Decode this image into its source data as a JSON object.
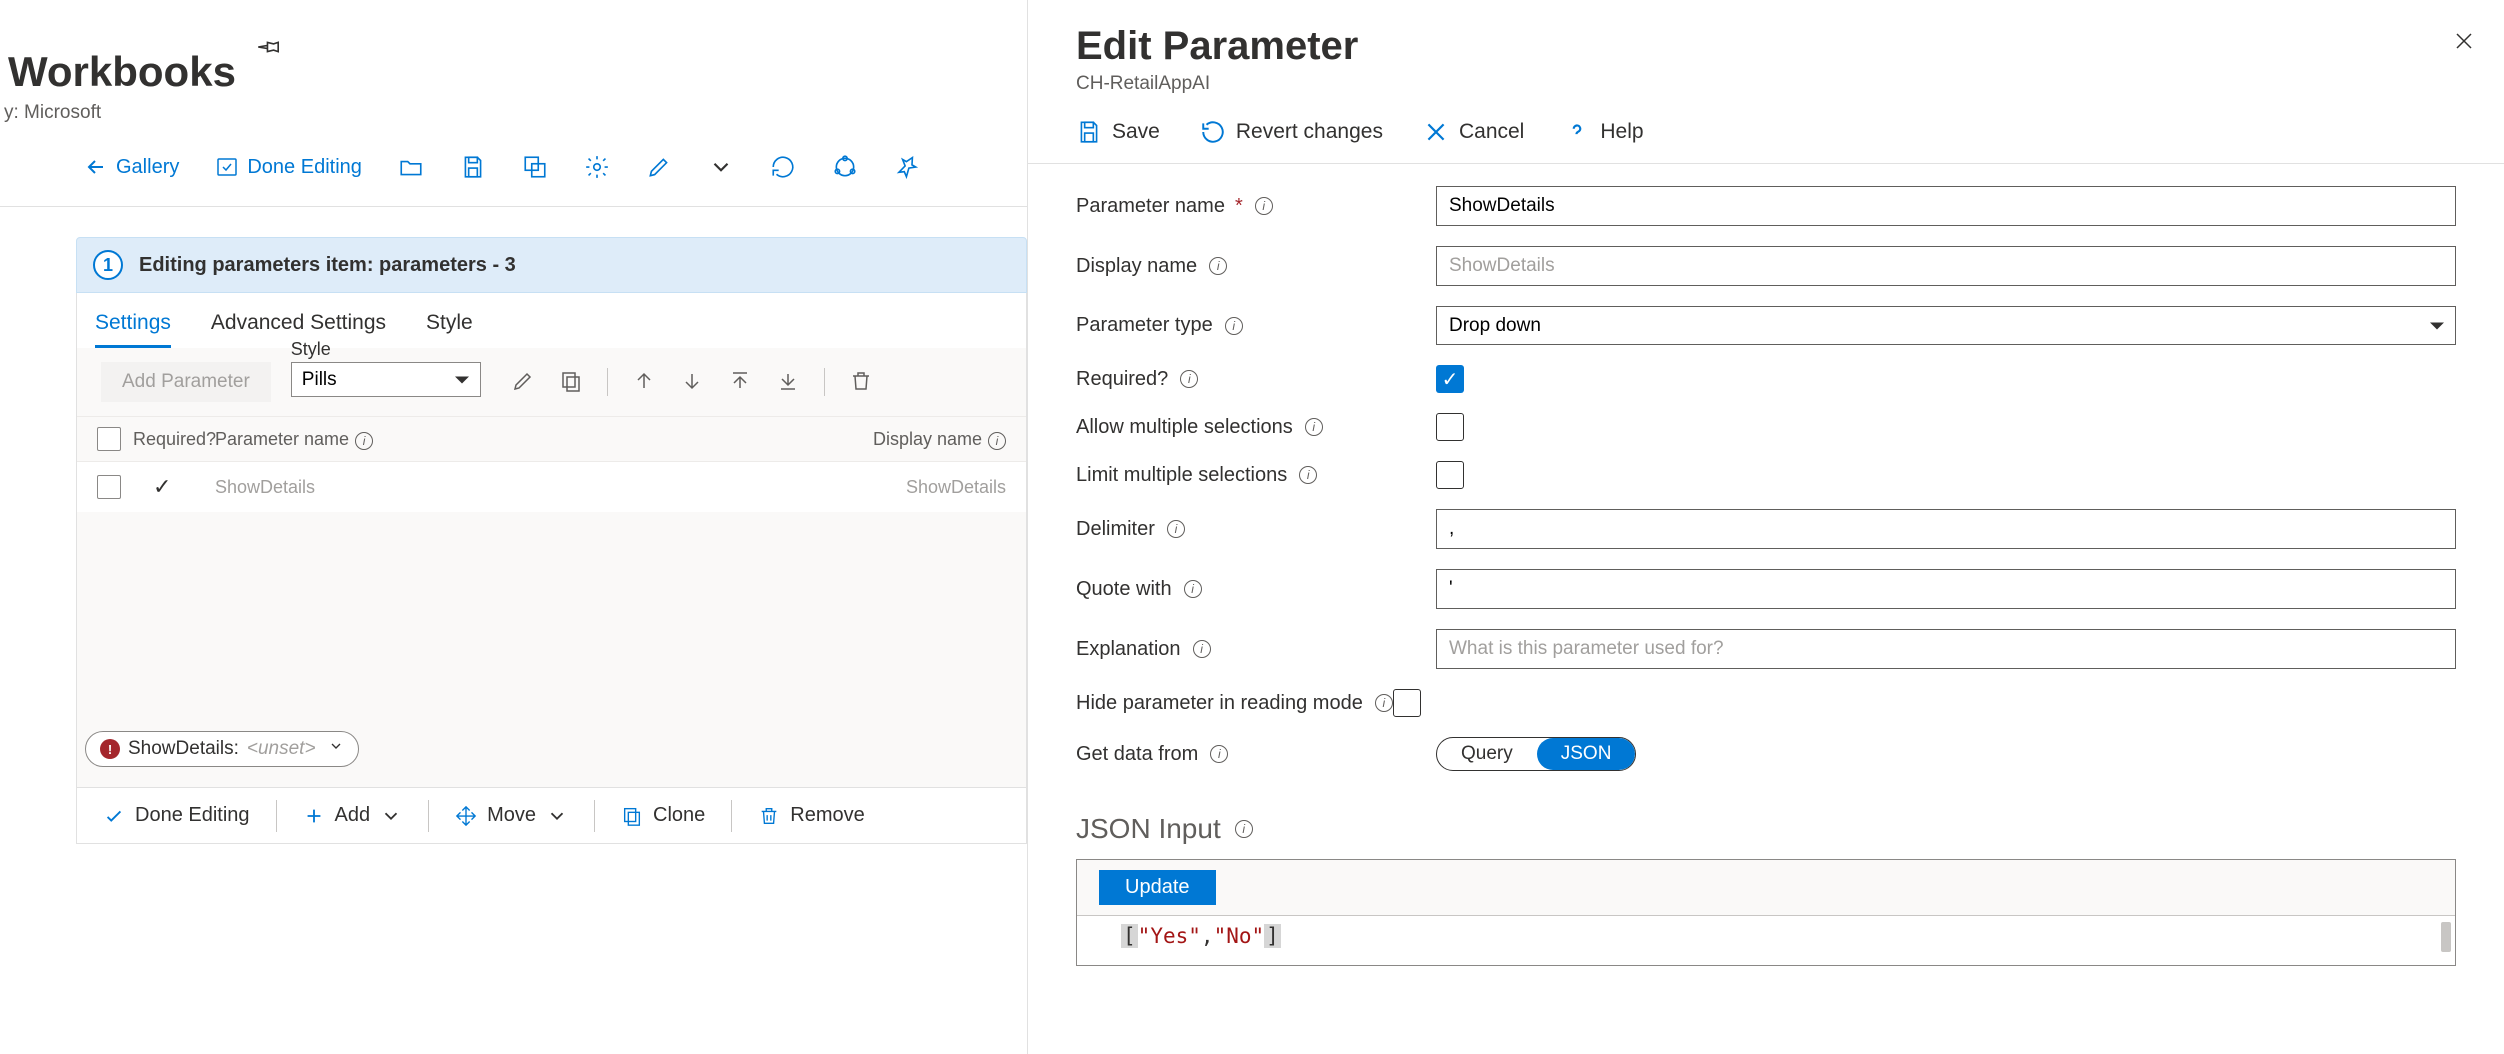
{
  "page": {
    "title": "Workbooks",
    "subtitle": "y: Microsoft"
  },
  "toolbar": {
    "gallery": "Gallery",
    "done_editing": "Done Editing"
  },
  "item": {
    "step": "1",
    "header": "Editing parameters item: parameters - 3",
    "tabs": {
      "settings": "Settings",
      "advanced": "Advanced Settings",
      "style": "Style"
    },
    "add_param": "Add Parameter",
    "style_label": "Style",
    "style_value": "Pills",
    "cols": {
      "required": "Required?",
      "pname": "Parameter name",
      "dname": "Display name"
    },
    "row": {
      "pname": "ShowDetails",
      "dname": "ShowDetails"
    },
    "pill": {
      "name": "ShowDetails:",
      "value": "<unset>"
    }
  },
  "bbar": {
    "done": "Done Editing",
    "add": "Add",
    "move": "Move",
    "clone": "Clone",
    "remove": "Remove"
  },
  "rp": {
    "title": "Edit Parameter",
    "sub": "CH-RetailAppAI",
    "save": "Save",
    "revert": "Revert changes",
    "cancel": "Cancel",
    "help": "Help",
    "labels": {
      "pname": "Parameter name",
      "dname": "Display name",
      "ptype": "Parameter type",
      "required": "Required?",
      "multi": "Allow multiple selections",
      "limit": "Limit multiple selections",
      "delim": "Delimiter",
      "quote": "Quote with",
      "explain": "Explanation",
      "hide": "Hide parameter in reading mode",
      "getdata": "Get data from"
    },
    "values": {
      "pname": "ShowDetails",
      "dname_ph": "ShowDetails",
      "ptype": "Drop down",
      "delim": ",",
      "quote": "'",
      "explain_ph": "What is this parameter used for?"
    },
    "toggle": {
      "query": "Query",
      "json": "JSON"
    },
    "json_title": "JSON Input",
    "update": "Update"
  },
  "chart_data": {
    "type": "table",
    "json_input": [
      "Yes",
      "No"
    ]
  }
}
